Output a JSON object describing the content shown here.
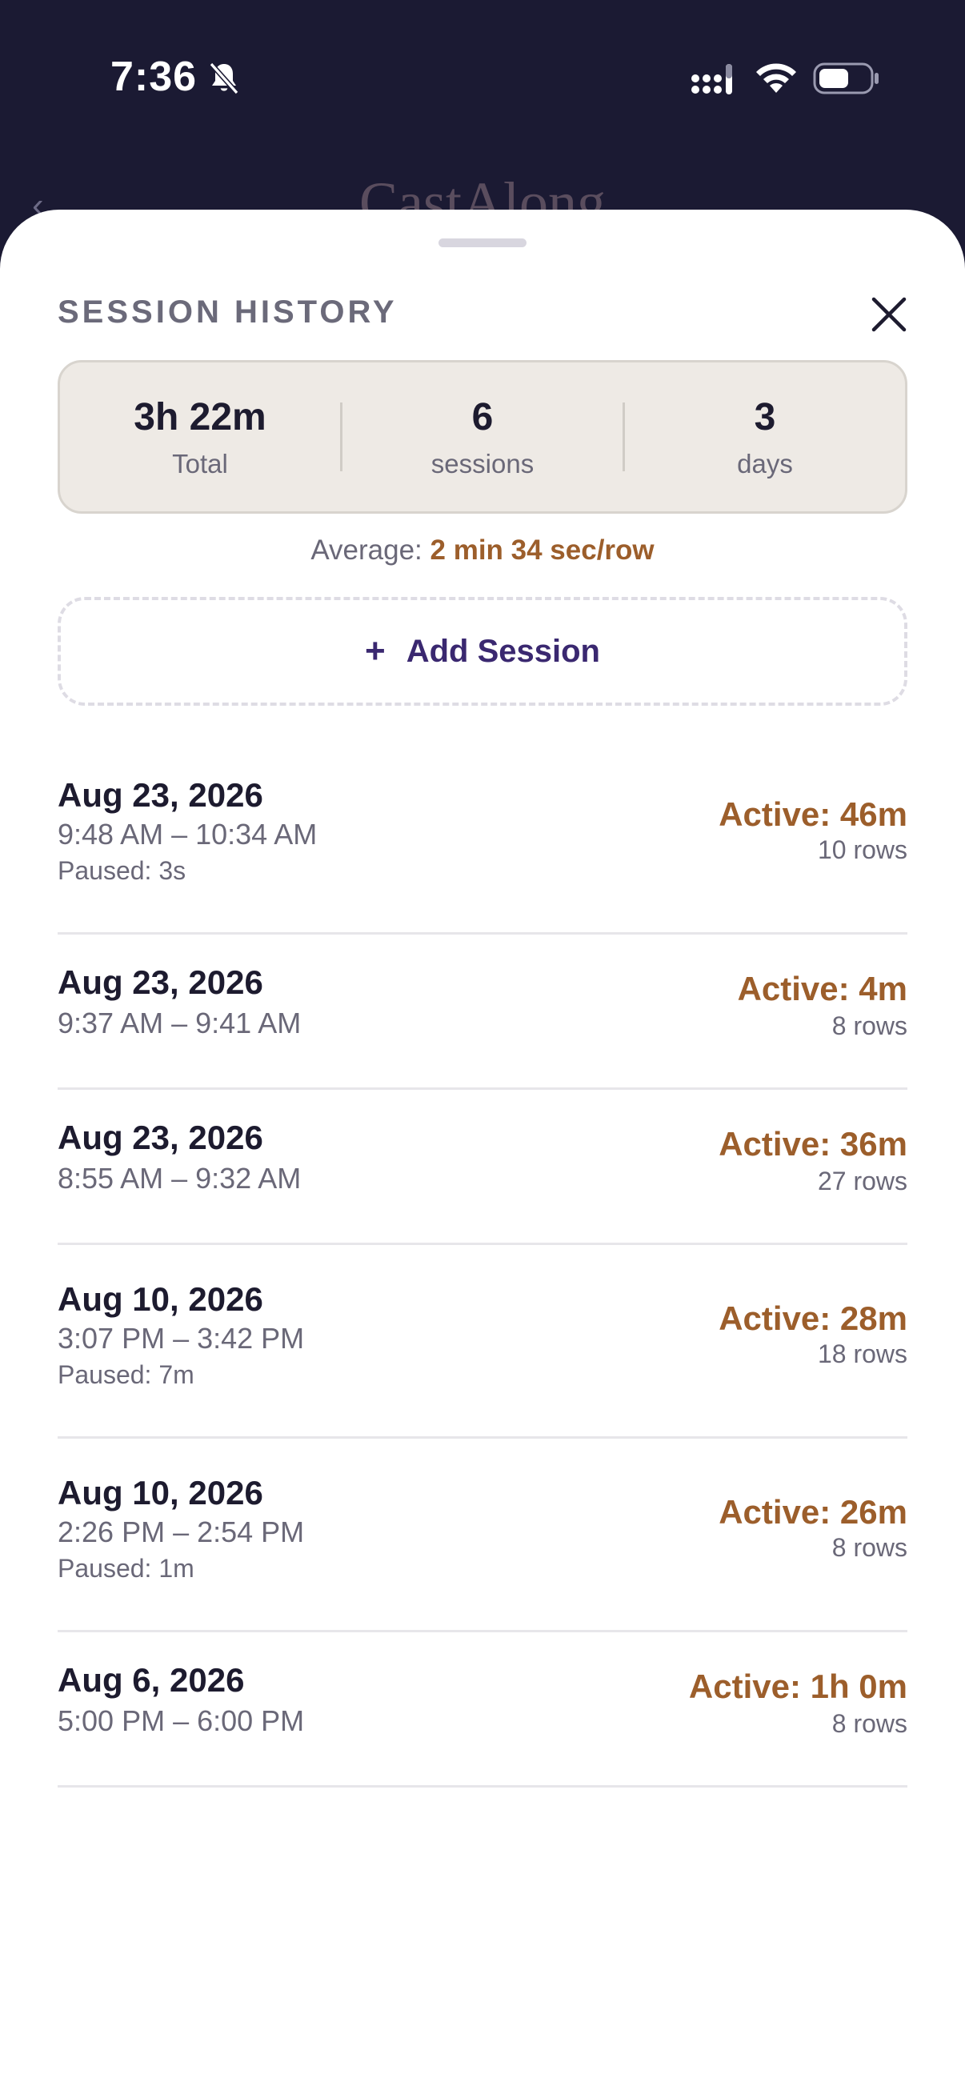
{
  "status_bar": {
    "time": "7:36",
    "icons": [
      "bell-slash-icon",
      "signal-icon",
      "wifi-icon",
      "battery-icon"
    ]
  },
  "background_app": {
    "title": "CastAlong",
    "back_glyph": "‹"
  },
  "sheet": {
    "title": "SESSION HISTORY",
    "close_icon": "close-icon",
    "stats": {
      "total_value": "3h 22m",
      "total_label": "Total",
      "sessions_value": "6",
      "sessions_label": "sessions",
      "days_value": "3",
      "days_label": "days"
    },
    "average": {
      "label": "Average: ",
      "value": "2 min 34 sec/row"
    },
    "add_session": {
      "icon": "+",
      "label": "Add Session"
    },
    "sessions": [
      {
        "date": "Aug 23, 2026",
        "time": "9:48 AM – 10:34 AM",
        "paused": "Paused: 3s",
        "active": "Active: 46m",
        "rows": "10 rows"
      },
      {
        "date": "Aug 23, 2026",
        "time": "9:37 AM – 9:41 AM",
        "paused": "",
        "active": "Active: 4m",
        "rows": "8 rows"
      },
      {
        "date": "Aug 23, 2026",
        "time": "8:55 AM – 9:32 AM",
        "paused": "",
        "active": "Active: 36m",
        "rows": "27 rows"
      },
      {
        "date": "Aug 10, 2026",
        "time": "3:07 PM – 3:42 PM",
        "paused": "Paused: 7m",
        "active": "Active: 28m",
        "rows": "18 rows"
      },
      {
        "date": "Aug 10, 2026",
        "time": "2:26 PM – 2:54 PM",
        "paused": "Paused: 1m",
        "active": "Active: 26m",
        "rows": "8 rows"
      },
      {
        "date": "Aug 6, 2026",
        "time": "5:00 PM – 6:00 PM",
        "paused": "",
        "active": "Active: 1h 0m",
        "rows": "8 rows"
      }
    ]
  },
  "colors": {
    "header_bg": "#1b1a33",
    "accent_brown": "#9c5e2b",
    "accent_purple": "#3a2870",
    "stats_bg": "#eeeae5"
  }
}
